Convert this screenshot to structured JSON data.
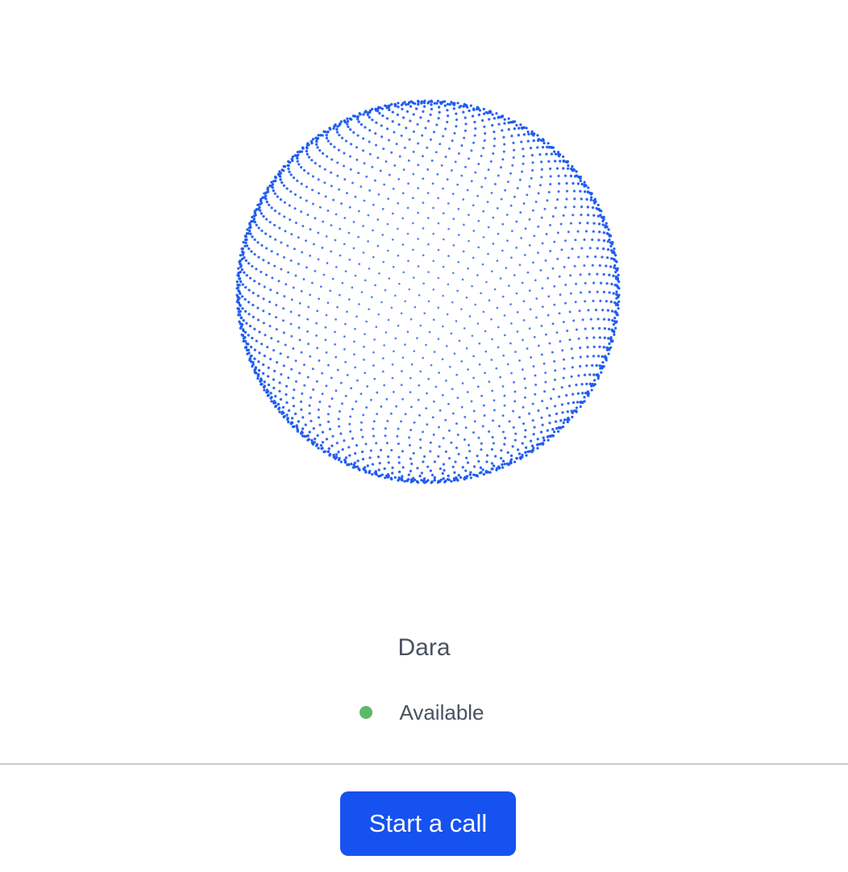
{
  "agent": {
    "name": "Dara",
    "status_label": "Available"
  },
  "actions": {
    "call_label": "Start a call"
  },
  "colors": {
    "orb_dots": "#1f5cf0",
    "status_available": "#5cb96a",
    "button_bg": "#1652f0",
    "divider": "#c9ccd1",
    "text": "#4a5260"
  },
  "icons": {
    "orb": "dotted-sphere-icon",
    "status": "status-dot-icon"
  }
}
